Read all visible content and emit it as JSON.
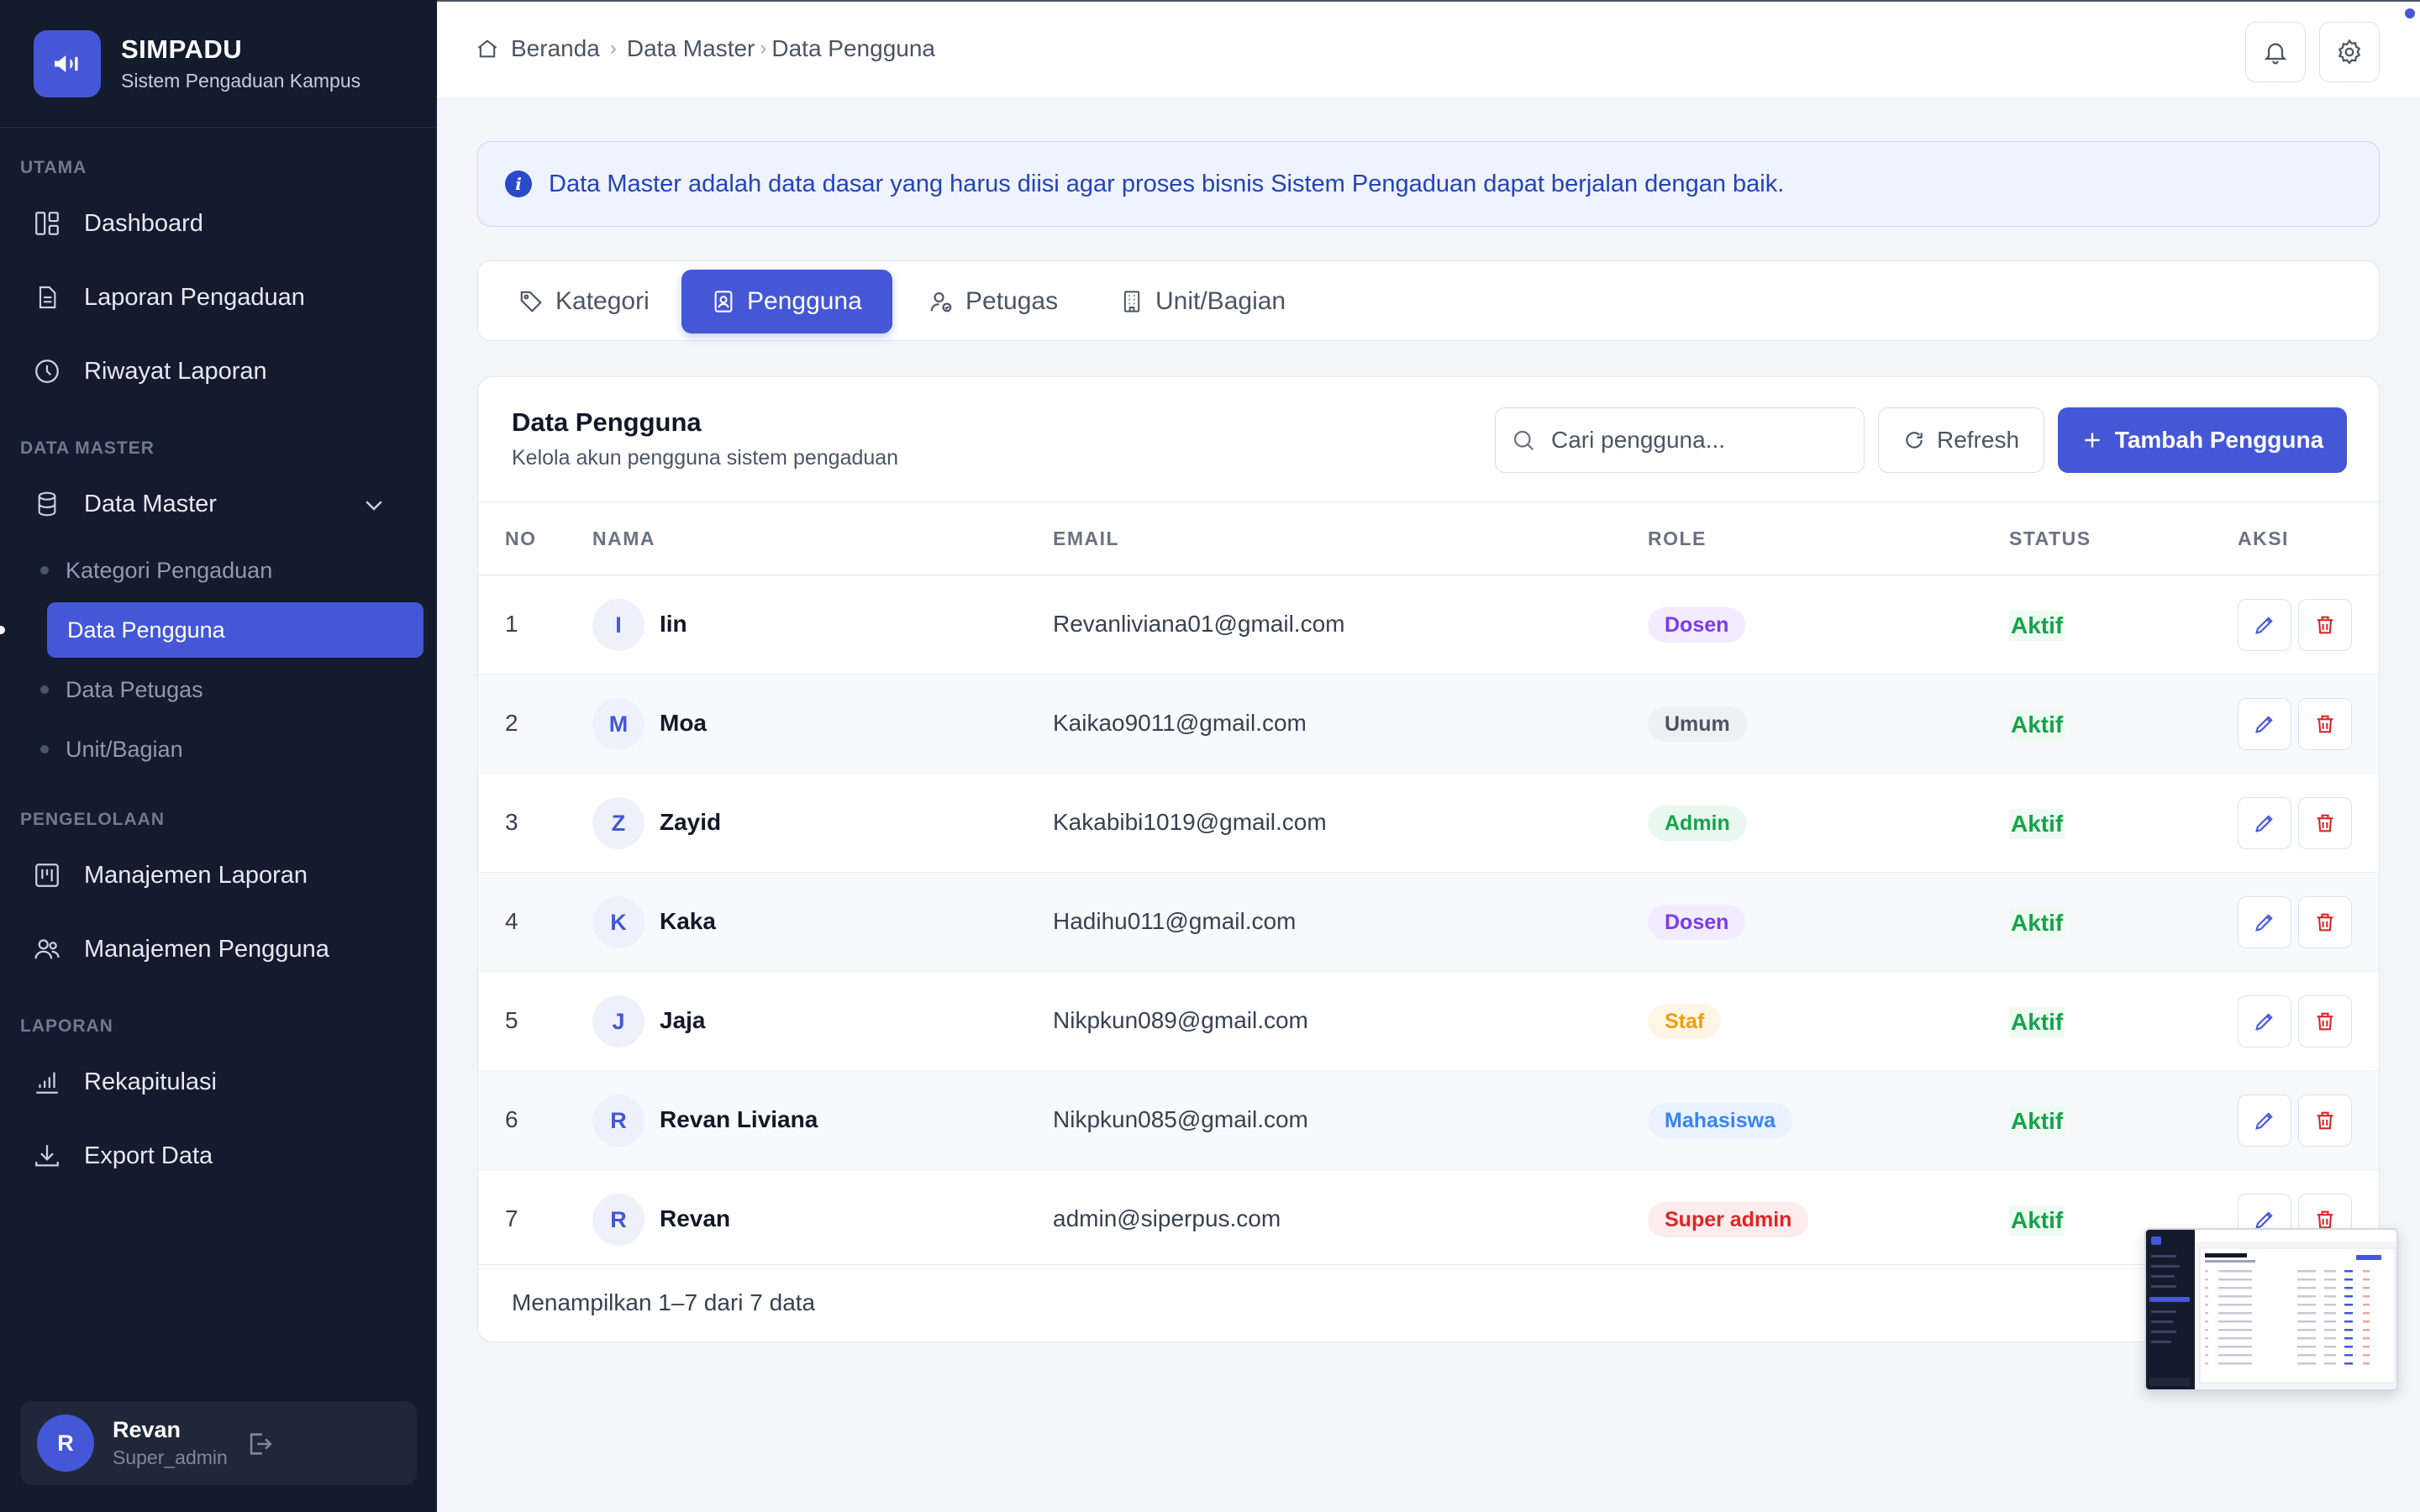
{
  "app": {
    "name": "SIMPADU",
    "subtitle": "Sistem Pengaduan Kampus"
  },
  "sidebar": {
    "sections": {
      "utama": "UTAMA",
      "data_master": "DATA MASTER",
      "pengelolaan": "PENGELOLAAN",
      "laporan": "LAPORAN"
    },
    "items": {
      "dashboard": "Dashboard",
      "laporan_pengaduan": "Laporan Pengaduan",
      "riwayat_laporan": "Riwayat Laporan",
      "data_master": "Data Master",
      "manajemen_laporan": "Manajemen Laporan",
      "manajemen_pengguna": "Manajemen Pengguna",
      "rekapitulasi": "Rekapitulasi",
      "export_data": "Export Data"
    },
    "sub_items": {
      "kategori": "Kategori Pengaduan",
      "pengguna": "Data Pengguna",
      "petugas": "Data Petugas",
      "unit": "Unit/Bagian"
    },
    "user": {
      "initial": "R",
      "name": "Revan",
      "role": "Super_admin"
    }
  },
  "breadcrumb": {
    "home": "Beranda",
    "level1": "Data Master",
    "level2": "Data Pengguna"
  },
  "info_banner": "Data Master adalah data dasar yang harus diisi agar proses bisnis Sistem Pengaduan dapat berjalan dengan baik.",
  "tabs": {
    "kategori": "Kategori",
    "pengguna": "Pengguna",
    "petugas": "Petugas",
    "unit": "Unit/Bagian"
  },
  "card": {
    "title": "Data Pengguna",
    "subtitle": "Kelola akun pengguna sistem pengaduan",
    "search_placeholder": "Cari pengguna...",
    "refresh_label": "Refresh",
    "add_label": "Tambah Pengguna",
    "columns": {
      "no": "NO",
      "nama": "NAMA",
      "email": "EMAIL",
      "role": "ROLE",
      "status": "STATUS",
      "aksi": "AKSI"
    },
    "rows": [
      {
        "no": "1",
        "initial": "I",
        "name": "Iin",
        "email": "Revanliviana01@gmail.com",
        "role": "Dosen",
        "status": "Aktif"
      },
      {
        "no": "2",
        "initial": "M",
        "name": "Moa",
        "email": "Kaikao9011@gmail.com",
        "role": "Umum",
        "status": "Aktif"
      },
      {
        "no": "3",
        "initial": "Z",
        "name": "Zayid",
        "email": "Kakabibi1019@gmail.com",
        "role": "Admin",
        "status": "Aktif"
      },
      {
        "no": "4",
        "initial": "K",
        "name": "Kaka",
        "email": "Hadihu011@gmail.com",
        "role": "Dosen",
        "status": "Aktif"
      },
      {
        "no": "5",
        "initial": "J",
        "name": "Jaja",
        "email": "Nikpkun089@gmail.com",
        "role": "Staf",
        "status": "Aktif"
      },
      {
        "no": "6",
        "initial": "R",
        "name": "Revan Liviana",
        "email": "Nikpkun085@gmail.com",
        "role": "Mahasiswa",
        "status": "Aktif"
      },
      {
        "no": "7",
        "initial": "R",
        "name": "Revan",
        "email": "admin@siperpus.com",
        "role": "Super admin",
        "status": "Aktif"
      }
    ],
    "footer": "Menampilkan 1–7 dari 7 data"
  },
  "colors": {
    "accent": "#4457d6",
    "sidebar_bg": "#141b2d",
    "status_active": "#16a34a",
    "role_dosen": "#7c3aed",
    "role_umum": "#4b5563",
    "role_admin": "#16a34a",
    "role_staf": "#f59e0b",
    "role_mahasiswa": "#3b82f6",
    "role_super_admin": "#dc2626"
  }
}
